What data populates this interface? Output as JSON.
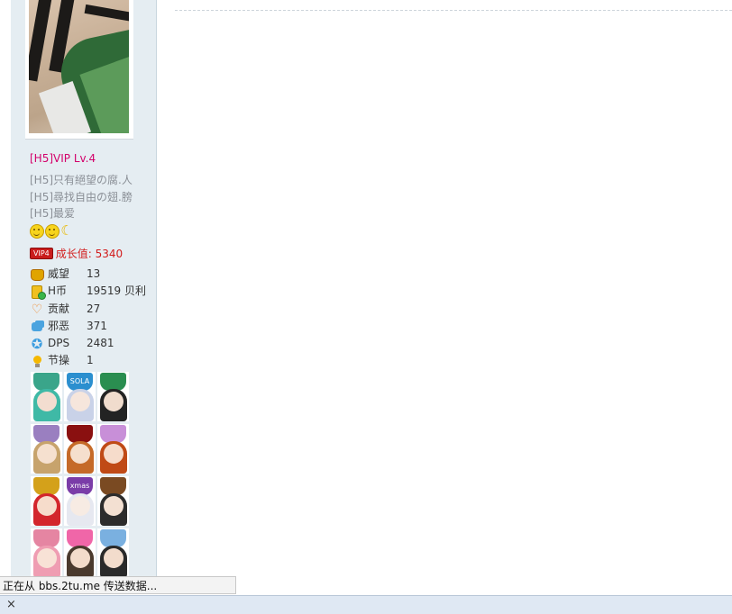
{
  "user": {
    "group_title": "[H5]VIP Lv.4",
    "custom_titles": [
      "[H5]只有絕望の腐.人",
      "[H5]尋找自由の翅.膀",
      "[H5]最爱"
    ],
    "emotes": [
      "smile-emote",
      "smile-emote",
      "moon-emote"
    ],
    "vip_badge": "VIP4",
    "growth": "成长值: 5340"
  },
  "stats": [
    {
      "icon": "crown-icon",
      "label": "威望",
      "value": "13"
    },
    {
      "icon": "coins-icon",
      "label": "H币",
      "value": "19519 贝利"
    },
    {
      "icon": "heart-icon",
      "label": "贡献",
      "value": "27"
    },
    {
      "icon": "puzzle-icon",
      "label": "邪恶",
      "value": "371"
    },
    {
      "icon": "star-icon",
      "label": "DPS",
      "value": "2481"
    },
    {
      "icon": "bulb-icon",
      "label": "节操",
      "value": "1"
    }
  ],
  "medals": [
    [
      "medal-green-teal",
      "medal-sola",
      "medal-sword-black"
    ],
    [
      "medal-purple-snow",
      "medal-red-dark",
      "medal-pink-orange"
    ],
    [
      "medal-gold-wings",
      "medal-xmas",
      "medal-brown-badge"
    ],
    [
      "medal-pink-ribbon",
      "medal-heart",
      "medal-lollipop"
    ]
  ],
  "medal_labels": {
    "sola": "SOLA",
    "xmas": "xmas"
  },
  "statusbar": {
    "text": "正在从 bbs.2tu.me 传送数据..."
  },
  "bottom_bar": {
    "close_label": "×"
  }
}
